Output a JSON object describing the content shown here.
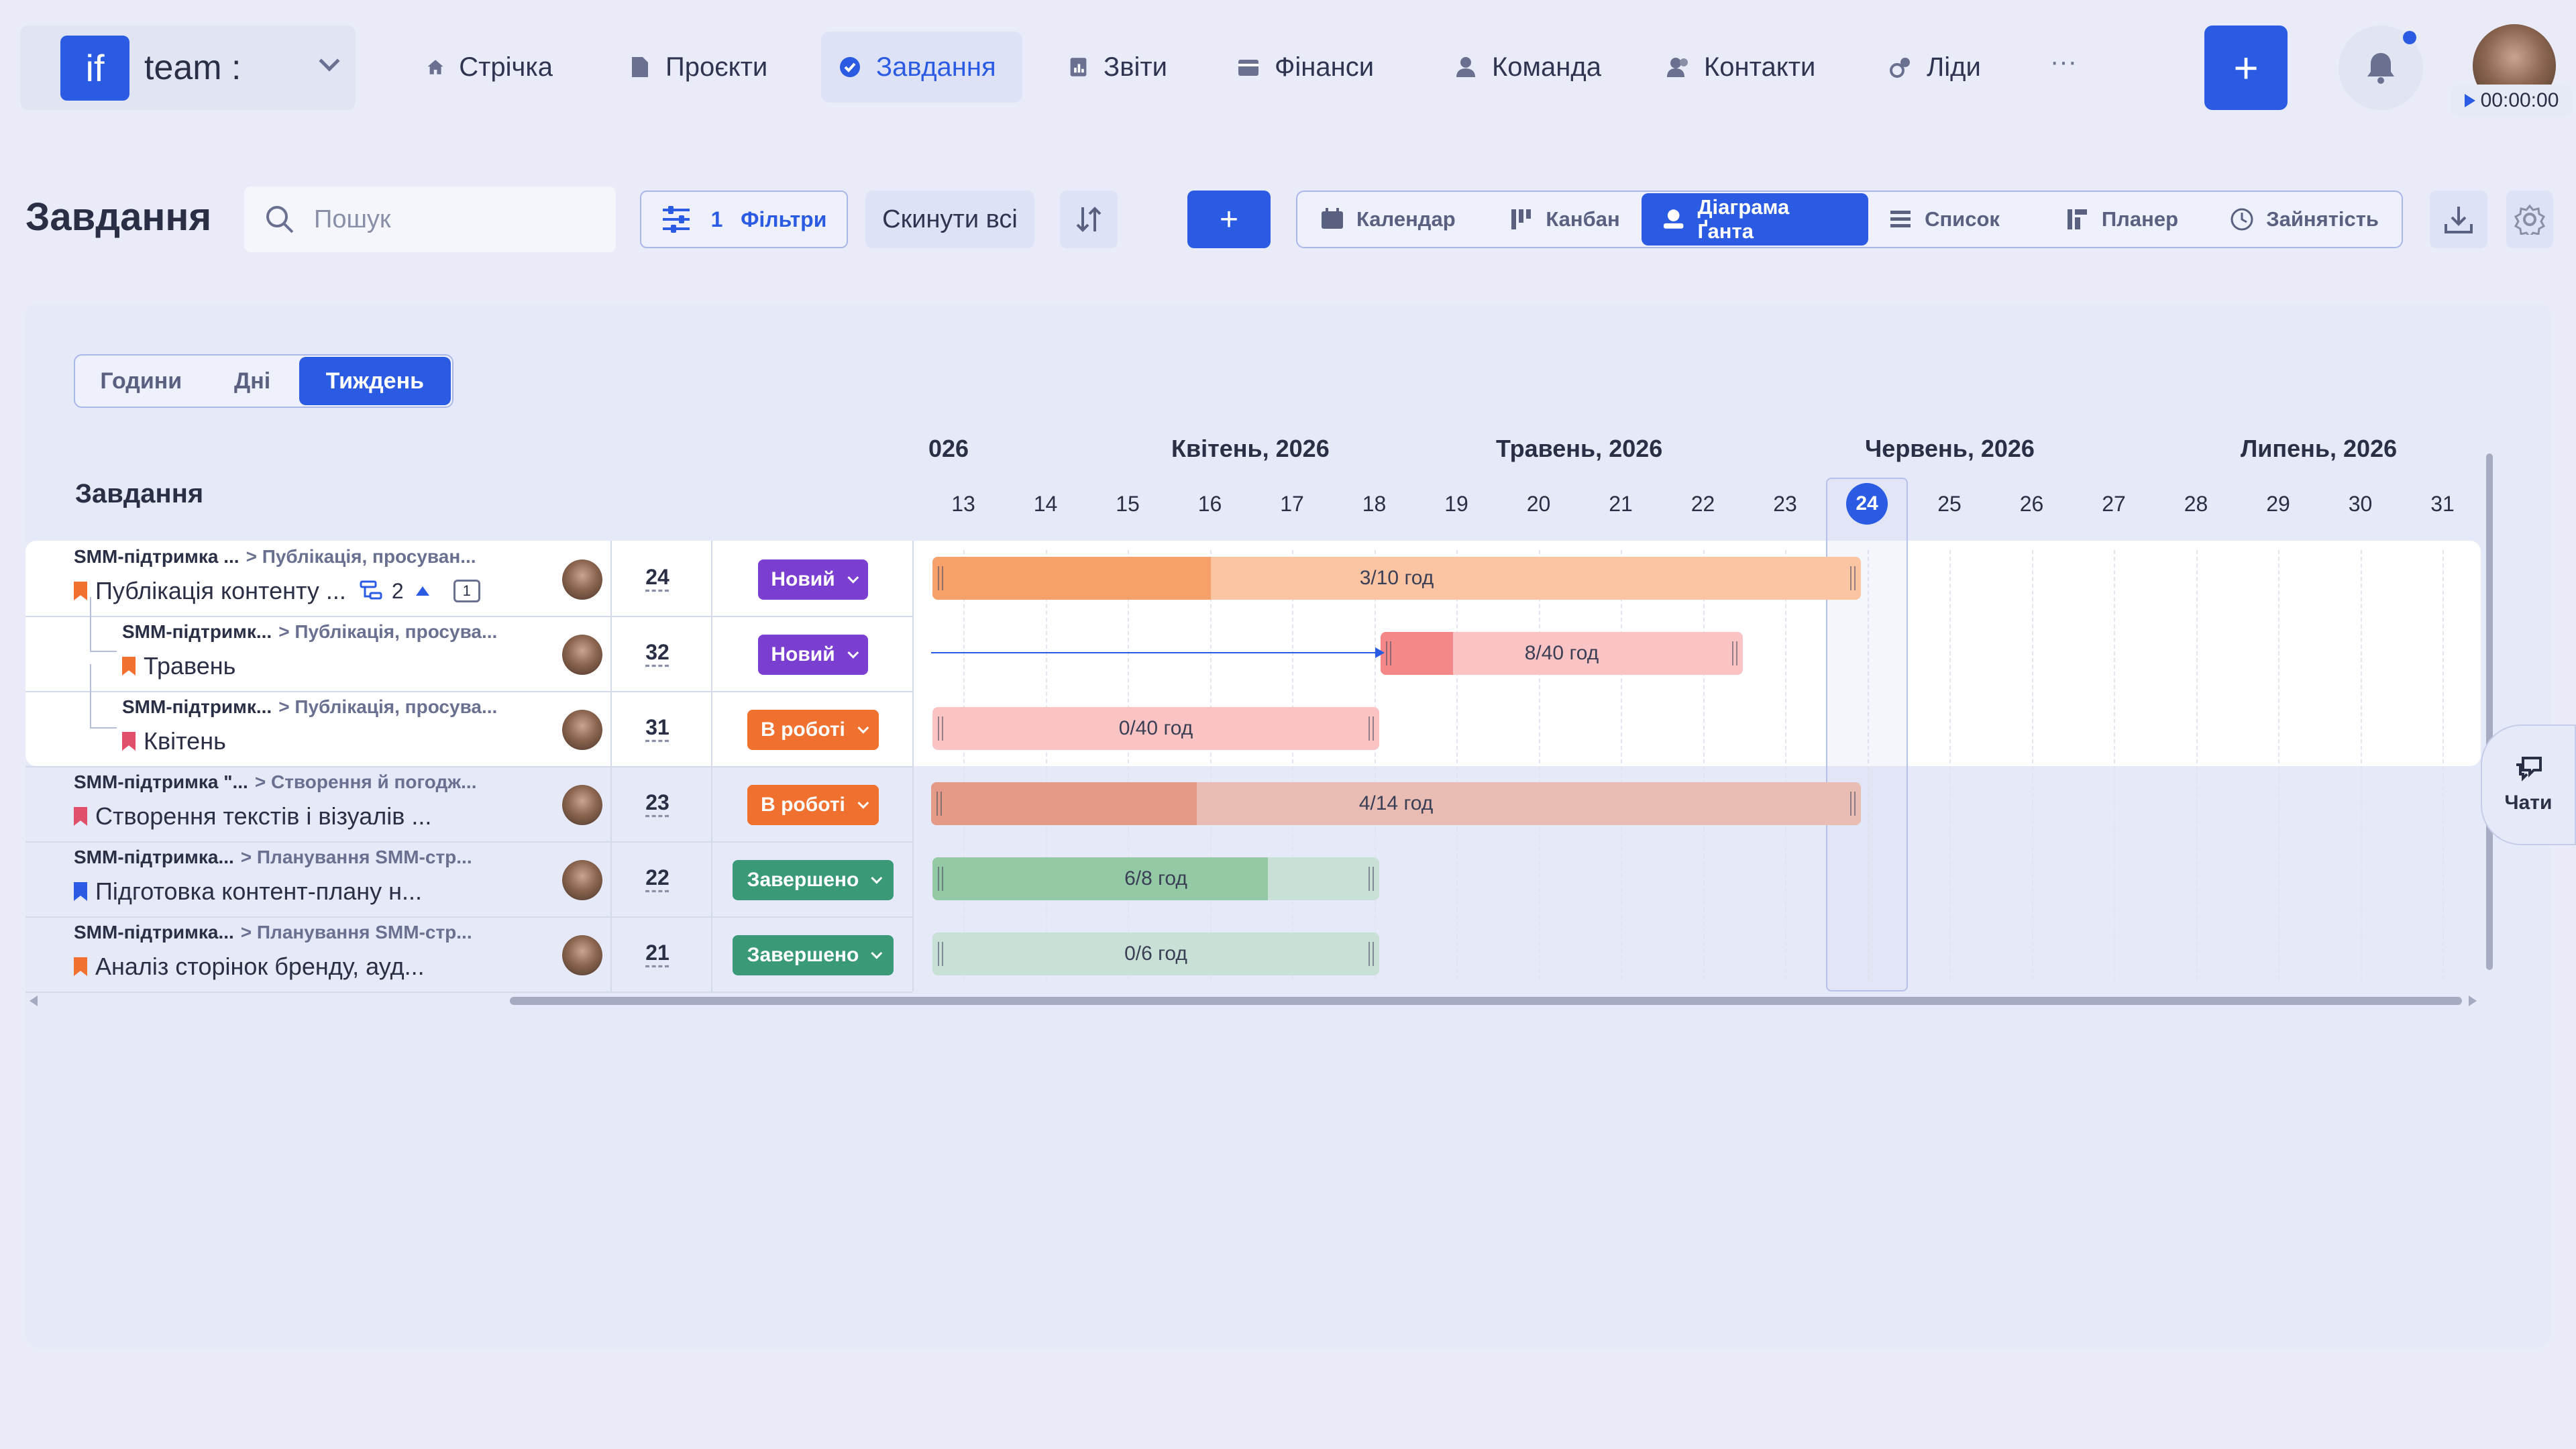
{
  "app": {
    "logo_mark": "if",
    "logo_text": "team :"
  },
  "nav": [
    {
      "label": "Стрічка",
      "icon": "home-icon"
    },
    {
      "label": "Проєкти",
      "icon": "document-icon"
    },
    {
      "label": "Завдання",
      "icon": "check-circle-icon",
      "active": true
    },
    {
      "label": "Звіти",
      "icon": "report-icon"
    },
    {
      "label": "Фінанси",
      "icon": "wallet-icon"
    },
    {
      "label": "Команда",
      "icon": "person-icon"
    },
    {
      "label": "Контакти",
      "icon": "contacts-icon"
    },
    {
      "label": "Ліди",
      "icon": "leads-icon"
    }
  ],
  "nav_more": "···",
  "timer": "00:00:00",
  "page": {
    "title": "Завдання"
  },
  "toolbar": {
    "search_placeholder": "Пошук",
    "filters_count": "1",
    "filters_label": "Фільтри",
    "reset_label": "Скинути всі",
    "add_label": "+"
  },
  "views": [
    {
      "label": "Календар",
      "icon": "calendar-icon"
    },
    {
      "label": "Канбан",
      "icon": "kanban-icon"
    },
    {
      "label": "Діаграма Ґанта",
      "icon": "gantt-icon",
      "active": true
    },
    {
      "label": "Список",
      "icon": "list-icon"
    },
    {
      "label": "Планер",
      "icon": "planner-icon"
    },
    {
      "label": "Зайнятість",
      "icon": "clock-icon"
    }
  ],
  "zoom": [
    {
      "label": "Години"
    },
    {
      "label": "Дні"
    },
    {
      "label": "Тиждень",
      "active": true
    }
  ],
  "gantt": {
    "left_header": "Завдання",
    "months": [
      "026",
      "Квітень, 2026",
      "Травень, 2026",
      "Червень, 2026",
      "Липень, 2026"
    ],
    "weeks": [
      "13",
      "14",
      "15",
      "16",
      "17",
      "18",
      "19",
      "20",
      "21",
      "22",
      "23",
      "24",
      "25",
      "26",
      "27",
      "28",
      "29",
      "30",
      "31"
    ],
    "today_week": "24",
    "rows": [
      {
        "project": "SMM-підтримка ...",
        "section": "> Публікація, просуван...",
        "title": "Публікація контенту ...",
        "flag_color": "#f07030",
        "number": "24",
        "status": "Новий",
        "status_color": "#7a3fd0",
        "subtasks": "2",
        "comments": "1",
        "bar_label": "3/10 год",
        "bar_color": "#fbc5a4",
        "fill_color": "#f6a06a",
        "progress": 0.3
      },
      {
        "project": "SMM-підтримк...",
        "section": "> Публікація, просува...",
        "title": "Травень",
        "flag_color": "#f07030",
        "number": "32",
        "status": "Новий",
        "status_color": "#7a3fd0",
        "bar_label": "8/40 год",
        "bar_color": "#fbc4c4",
        "fill_color": "#f48888",
        "progress": 0.2
      },
      {
        "project": "SMM-підтримк...",
        "section": "> Публікація, просува...",
        "title": "Квітень",
        "flag_color": "#e0506a",
        "number": "31",
        "status": "В роботі",
        "status_color": "#f07030",
        "bar_label": "0/40 год",
        "bar_color": "#fbc4c4",
        "fill_color": "#f48888",
        "progress": 0.0
      },
      {
        "project": "SMM-підтримка \"...",
        "section": "> Створення й погодж...",
        "title": "Створення текстів і візуалів ...",
        "flag_color": "#e0506a",
        "number": "23",
        "status": "В роботі",
        "status_color": "#f07030",
        "bar_label": "4/14 год",
        "bar_color": "#e9bcb4",
        "fill_color": "#e39a86",
        "progress": 0.286
      },
      {
        "project": "SMM-підтримка...",
        "section": "> Планування SMM-стр...",
        "title": "Підготовка контент-плану н...",
        "flag_color": "#2b5be3",
        "number": "22",
        "status": "Завершено",
        "status_color": "#3a9a78",
        "bar_label": "6/8 год",
        "bar_color": "#c9e0d6",
        "fill_color": "#94c9a5",
        "progress": 0.75
      },
      {
        "project": "SMM-підтримка...",
        "section": "> Планування SMM-стр...",
        "title": "Аналіз сторінок бренду, ауд...",
        "flag_color": "#f07030",
        "number": "21",
        "status": "Завершено",
        "status_color": "#3a9a78",
        "bar_label": "0/6 год",
        "bar_color": "#c9e0d6",
        "fill_color": "#94c9a5",
        "progress": 0.0
      }
    ]
  },
  "chats_label": "Чати"
}
